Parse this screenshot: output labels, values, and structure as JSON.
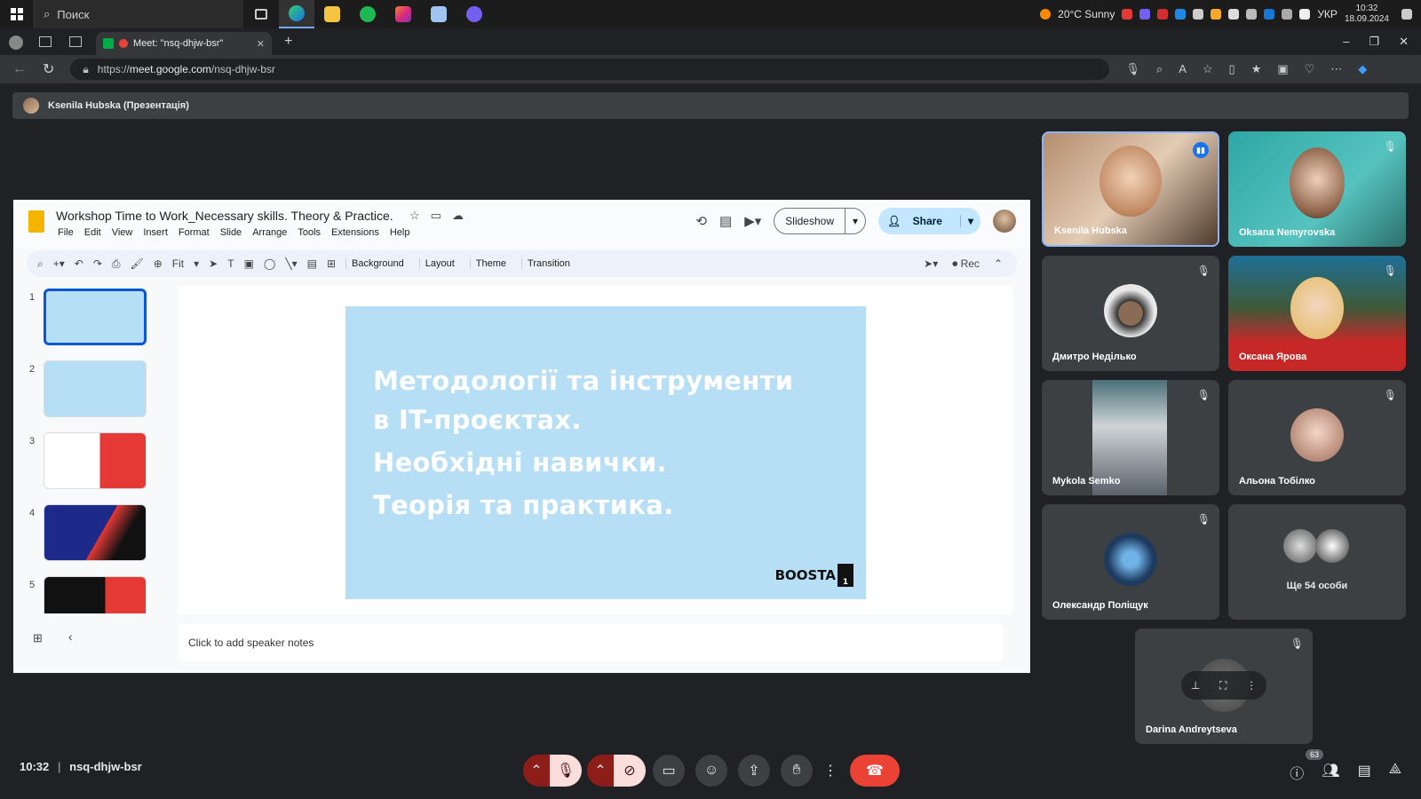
{
  "taskbar": {
    "search_placeholder": "Поиск",
    "weather": "20°C  Sunny",
    "lang": "УКР",
    "time": "10:32",
    "date": "18.09.2024"
  },
  "browser": {
    "tab_title": "Meet: \"nsq-dhjw-bsr\"",
    "url_prefix": "https://",
    "url_host": "meet.google.com",
    "url_path": "/nsq-dhjw-bsr"
  },
  "presenter": {
    "label": "Ksenila Hubska (Презентація)"
  },
  "slides_app": {
    "title": "Workshop Time to Work_Necessary skills. Theory & Practice.",
    "menus": [
      "File",
      "Edit",
      "View",
      "Insert",
      "Format",
      "Slide",
      "Arrange",
      "Tools",
      "Extensions",
      "Help"
    ],
    "slideshow_label": "Slideshow",
    "share_label": "Share",
    "zoom_label": "Fit",
    "toolbar_buttons": [
      "Background",
      "Layout",
      "Theme",
      "Transition"
    ],
    "rec_label": "Rec",
    "thumbs": [
      "1",
      "2",
      "3",
      "4",
      "5"
    ],
    "slide_text": [
      "Методології та інструменти",
      "в IT-проєктах.",
      "Необхідні навички.",
      "Теорія та практика."
    ],
    "slide_logo": "BOOSTA",
    "slide_page": "1",
    "notes_placeholder": "Click to add speaker notes"
  },
  "participants": [
    {
      "name": "Ksenila Hubska"
    },
    {
      "name": "Oksana Nemyrovska"
    },
    {
      "name": "Дмитро Неділько"
    },
    {
      "name": "Оксана Ярова"
    },
    {
      "name": "Mykola Semko"
    },
    {
      "name": "Альона Тобілко"
    },
    {
      "name": "Олександр Поліщук"
    },
    {
      "name": "Ще 54 особи"
    },
    {
      "name": "Darina Andreytseva"
    }
  ],
  "meeting": {
    "time": "10:32",
    "code": "nsq-dhjw-bsr",
    "people_count": "63"
  },
  "colors": {
    "end_call": "#ea4335",
    "muted_bg": "#8c1d18",
    "accent": "#1a73e8"
  }
}
